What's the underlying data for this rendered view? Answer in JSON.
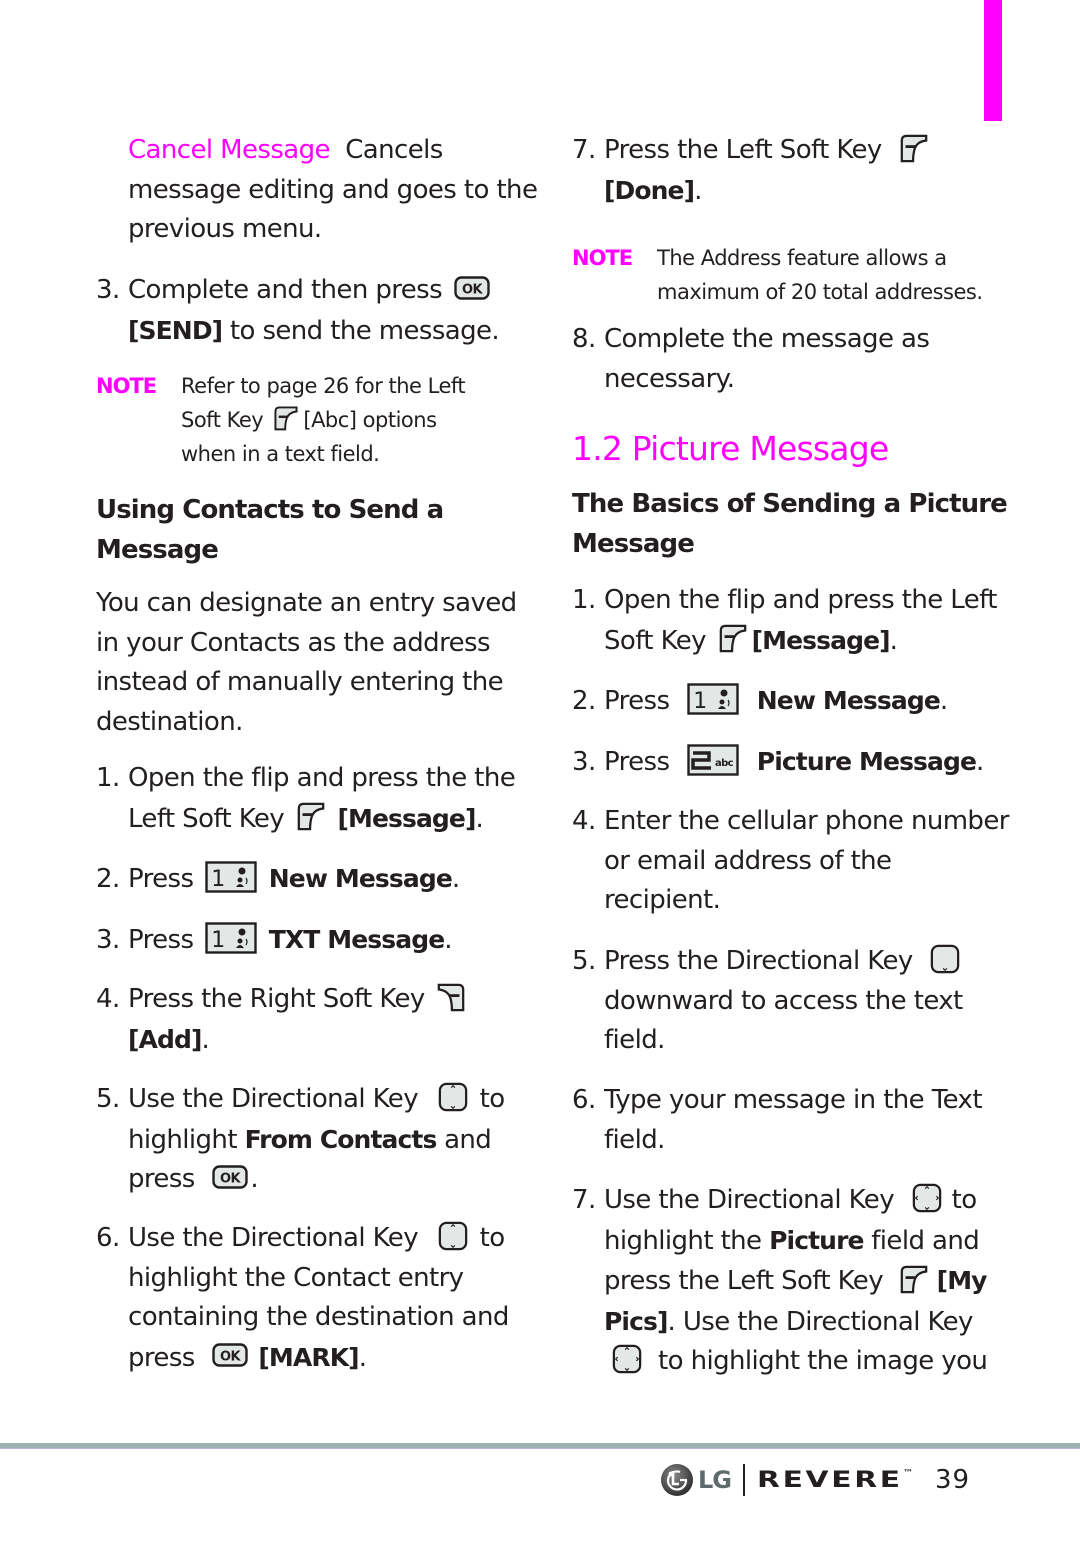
{
  "colors": {
    "accent": "#ff00ff",
    "text": "#231f20",
    "footer_rule": "#9fb3b3"
  },
  "left": {
    "cancel": {
      "term": "Cancel Message",
      "desc_1": "Cancels",
      "desc_2": "message editing and goes to the",
      "desc_3": "previous menu."
    },
    "step3": {
      "num": "3.",
      "line1": "Complete and then press",
      "line2_bold": "[SEND]",
      "line2": "to send the message."
    },
    "note1": {
      "label": "NOTE",
      "line1": "Refer to page 26 for the Left",
      "line2a": "Soft Key",
      "line2b": "[Abc] options",
      "line3": "when in a text field."
    },
    "section_heading_1": "Using Contacts to Send a",
    "section_heading_2": "Message",
    "intro": [
      "You can designate an entry saved",
      "in your Contacts as the address",
      "instead of manually entering the",
      "destination."
    ],
    "steps": [
      {
        "num": "1.",
        "line1": "Open the flip and press the the",
        "line2a": "Left Soft Key",
        "line2_bold": "[Message]",
        "line2_end": "."
      },
      {
        "num": "2.",
        "text": "Press",
        "bold": "New Message",
        "end": "."
      },
      {
        "num": "3.",
        "text": "Press",
        "bold": "TXT Message",
        "end": "."
      },
      {
        "num": "4.",
        "line1": "Press the Right Soft Key",
        "line2_bold": "[Add]",
        "line2_end": "."
      },
      {
        "num": "5.",
        "line1a": "Use the Directional Key",
        "line1b": "to",
        "line2a": "highlight",
        "line2_bold": "From Contacts",
        "line2b": "and",
        "line3a": "press",
        "line3_end": "."
      },
      {
        "num": "6.",
        "line1a": "Use the Directional Key",
        "line1b": "to",
        "line2": "highlight the Contact entry",
        "line3": "containing the destination and",
        "line4a": "press",
        "line4_bold": "[MARK]",
        "line4_end": "."
      }
    ]
  },
  "right": {
    "step7": {
      "num": "7.",
      "line1": "Press the Left Soft Key",
      "line2_bold": "[Done]",
      "line2_end": "."
    },
    "note2": {
      "label": "NOTE",
      "line1": "The Address feature allows a",
      "line2": "maximum of 20 total addresses."
    },
    "step8": {
      "num": "8.",
      "line1": "Complete the message as",
      "line2": "necessary."
    },
    "section_title": "1.2 Picture Message",
    "sub_heading_1": "The Basics of Sending a Picture",
    "sub_heading_2": "Message",
    "steps": [
      {
        "num": "1.",
        "line1": "Open the flip and press the Left",
        "line2a": "Soft Key",
        "line2_bold": "[Message]",
        "line2_end": "."
      },
      {
        "num": "2.",
        "text": "Press",
        "bold": "New Message",
        "end": "."
      },
      {
        "num": "3.",
        "text": "Press",
        "bold": "Picture Message",
        "end": "."
      },
      {
        "num": "4.",
        "line1": "Enter the cellular phone number",
        "line2": "or email address of the",
        "line3": "recipient."
      },
      {
        "num": "5.",
        "line1": "Press the Directional Key",
        "line2": "downward to access the text",
        "line3": "field."
      },
      {
        "num": "6.",
        "line1": "Type your message in the Text",
        "line2": "field."
      },
      {
        "num": "7.",
        "line1a": "Use the Directional Key",
        "line1b": "to",
        "line2a": "highlight the",
        "line2_bold": "Picture",
        "line2b": "field and",
        "line3a": "press the Left Soft Key",
        "line3_bold": "[My",
        "line4_bold": "Pics]",
        "line4": ". Use the Directional Key",
        "line5": "to highlight the image you"
      }
    ]
  },
  "footer": {
    "brand": "LG",
    "product": "REVERE",
    "trademark": "™",
    "page_number": "39"
  },
  "icons": {
    "ok_key_label": "OK",
    "key1_label": "1",
    "key2_label": "2",
    "key2_sub": "abc"
  }
}
